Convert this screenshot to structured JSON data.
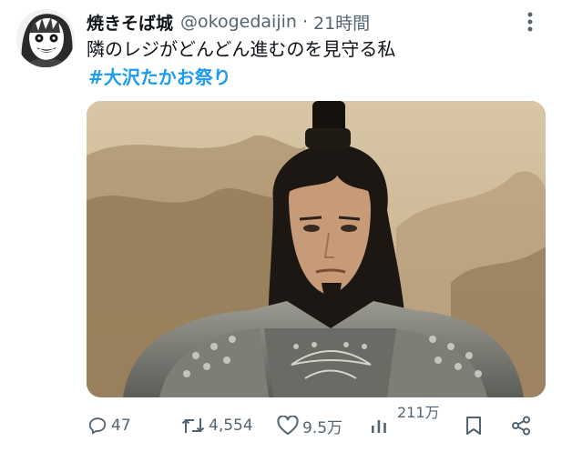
{
  "user": {
    "display_name": "焼きそば城",
    "handle": "@okogedaijin",
    "separator": "·",
    "time": "21時間"
  },
  "tweet": {
    "text": "隣のレジがどんどん進むのを見守る私",
    "hashtag": "#大沢たかお祭り"
  },
  "media": {
    "description_icon": "photo-armored-warrior"
  },
  "actions": {
    "replies": "47",
    "retweets": "4,554",
    "likes": "9.5万",
    "views": "211万"
  },
  "colors": {
    "text": "#0f1419",
    "secondary": "#536471",
    "link": "#1d9bf0"
  },
  "icons": {
    "more": "more-vertical-icon",
    "reply": "reply-icon",
    "retweet": "retweet-icon",
    "like": "heart-icon",
    "views": "views-bar-chart-icon",
    "bookmark": "bookmark-icon",
    "share": "share-icon"
  }
}
